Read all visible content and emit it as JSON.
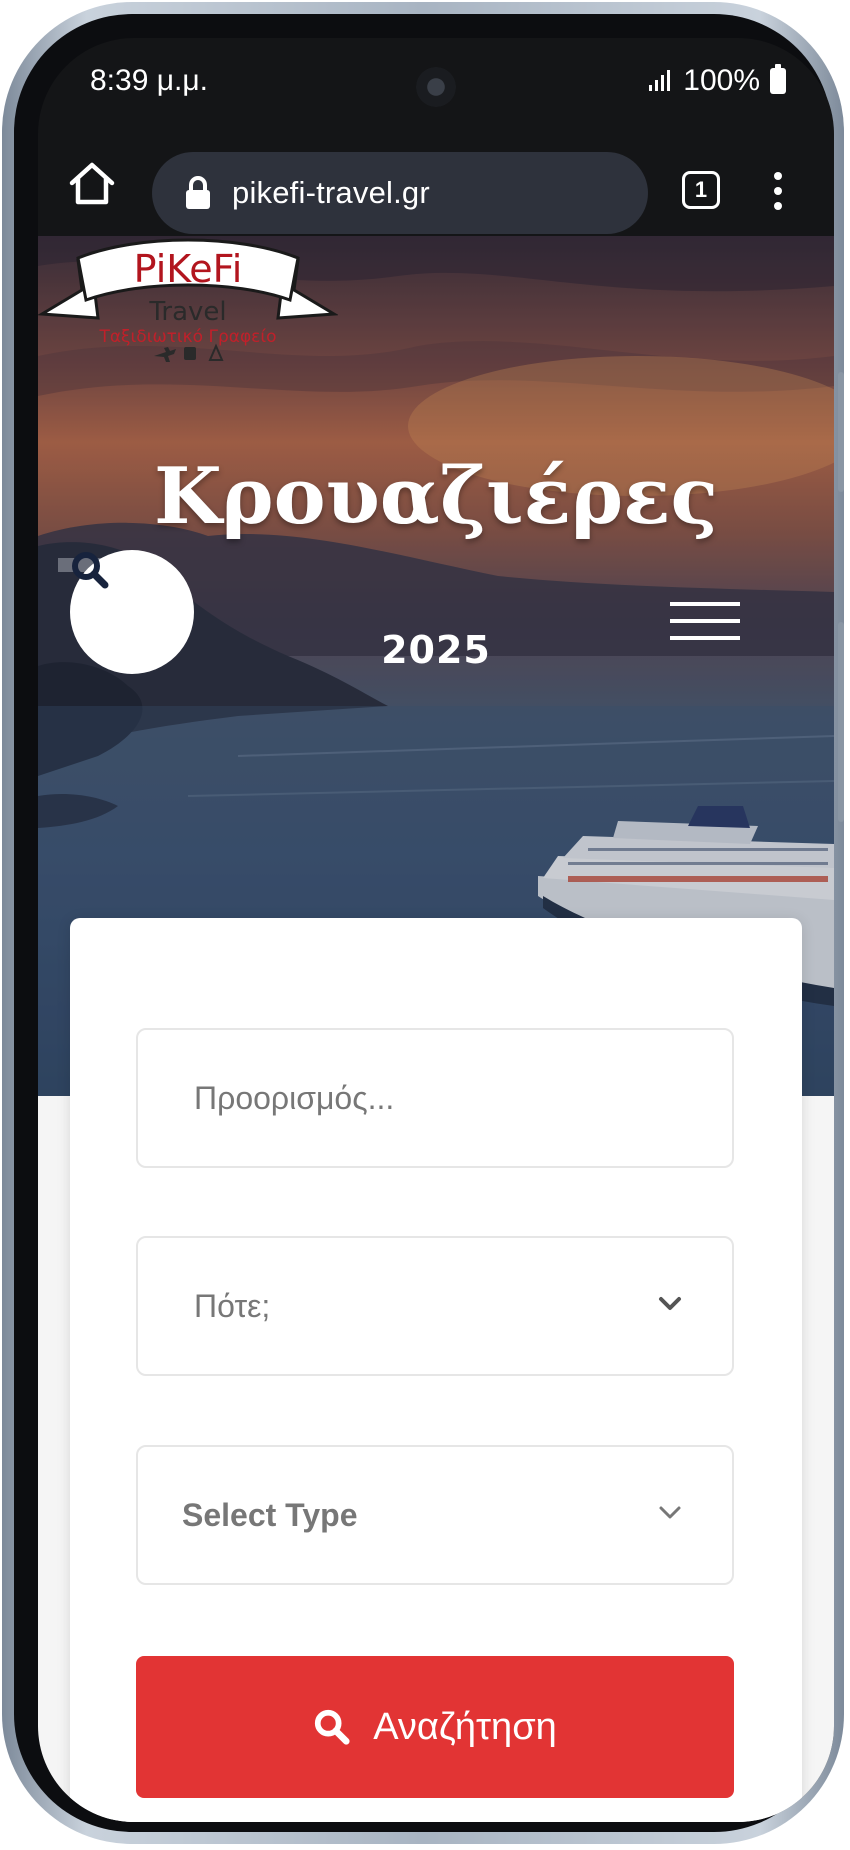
{
  "status_bar": {
    "time": "8:39 μ.μ.",
    "battery": "100%"
  },
  "browser": {
    "url": "pikefi-travel.gr",
    "tab_count": "1"
  },
  "logo": {
    "brand": "PiKeFi",
    "sub": "Travel",
    "tagline": "Ταξιδιωτικό Γραφείο"
  },
  "hero": {
    "title": "Κρουαζιέρες",
    "year": "2025"
  },
  "search_form": {
    "destination_placeholder": "Προορισμός...",
    "when_label": "Πότε;",
    "type_label": "Select Type",
    "submit_label": "Αναζήτηση"
  },
  "colors": {
    "accent": "#e23434",
    "logo_red": "#b2151e"
  },
  "icons": [
    "home-icon",
    "lock-icon",
    "tabs-icon",
    "more-vert-icon",
    "search-icon",
    "hamburger-menu-icon",
    "chevron-down-icon",
    "signal-icon",
    "battery-icon"
  ]
}
